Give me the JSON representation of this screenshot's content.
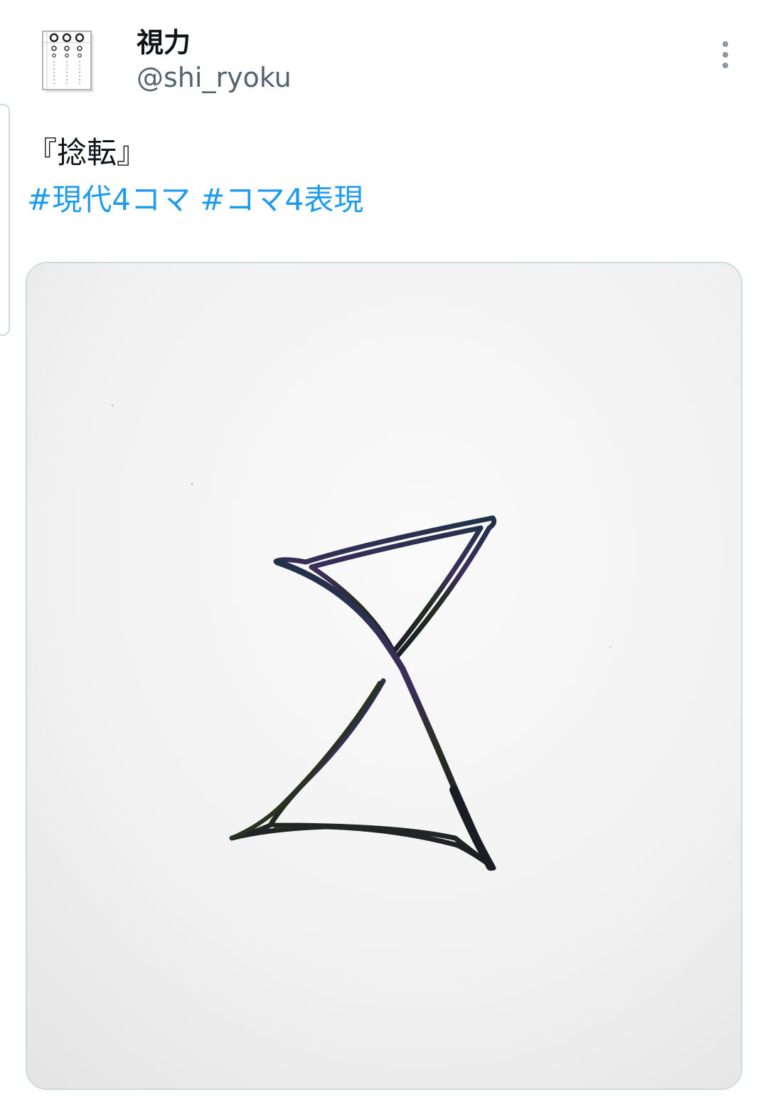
{
  "tweet": {
    "author": {
      "display_name": "視力",
      "handle": "@shi_ryoku"
    },
    "text_title": "『捻転』",
    "hashtags": [
      "#現代4コマ",
      "#コマ4表現"
    ],
    "media": {
      "kind": "photo",
      "subject": "hand-drawn-hourglass"
    }
  },
  "icons": {
    "more": "vertical-ellipsis-icon",
    "avatar": "eye-chart-avatar"
  },
  "colors": {
    "hashtag": "#1d9bf0",
    "secondary_text": "#536471",
    "border": "#cfd9de",
    "primary_text": "#0f1419"
  }
}
